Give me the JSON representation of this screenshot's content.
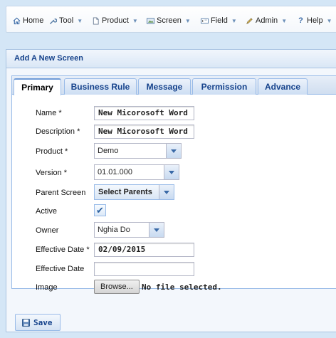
{
  "menu": [
    {
      "label": "Home",
      "icon": "home-icon",
      "has_dropdown": false
    },
    {
      "label": "Tool",
      "icon": "wrench-icon",
      "has_dropdown": true
    },
    {
      "label": "Product",
      "icon": "document-icon",
      "has_dropdown": true
    },
    {
      "label": "Screen",
      "icon": "screen-icon",
      "has_dropdown": true
    },
    {
      "label": "Field",
      "icon": "field-icon",
      "has_dropdown": true
    },
    {
      "label": "Admin",
      "icon": "pencil-icon",
      "has_dropdown": true
    },
    {
      "label": "Help",
      "icon": "help-icon",
      "has_dropdown": true
    }
  ],
  "panel": {
    "title": "Add A New Screen"
  },
  "tabs": [
    {
      "label": "Primary",
      "active": true
    },
    {
      "label": "Business Rule",
      "active": false
    },
    {
      "label": "Message",
      "active": false
    },
    {
      "label": "Permission",
      "active": false
    },
    {
      "label": "Advance",
      "active": false
    }
  ],
  "form": {
    "name": {
      "label": "Name *",
      "value": "New Micorosoft Word"
    },
    "description": {
      "label": "Description *",
      "value": "New Micorosoft Word"
    },
    "product": {
      "label": "Product *",
      "value": "Demo"
    },
    "version": {
      "label": "Version *",
      "value": "01.01.000"
    },
    "parent_screen": {
      "label": "Parent Screen",
      "value": "Select Parents"
    },
    "active": {
      "label": "Active",
      "checked": true
    },
    "owner": {
      "label": "Owner",
      "value": "Nghia Do"
    },
    "effective_date_required": {
      "label": "Effective Date *",
      "value": "02/09/2015"
    },
    "effective_date": {
      "label": "Effective Date",
      "value": ""
    },
    "image": {
      "label": "Image",
      "button": "Browse...",
      "status": "No file selected."
    }
  },
  "actions": {
    "save": "Save"
  },
  "colors": {
    "accent": "#15428b",
    "background": "#d4e6f6",
    "border": "#99bbe8"
  }
}
